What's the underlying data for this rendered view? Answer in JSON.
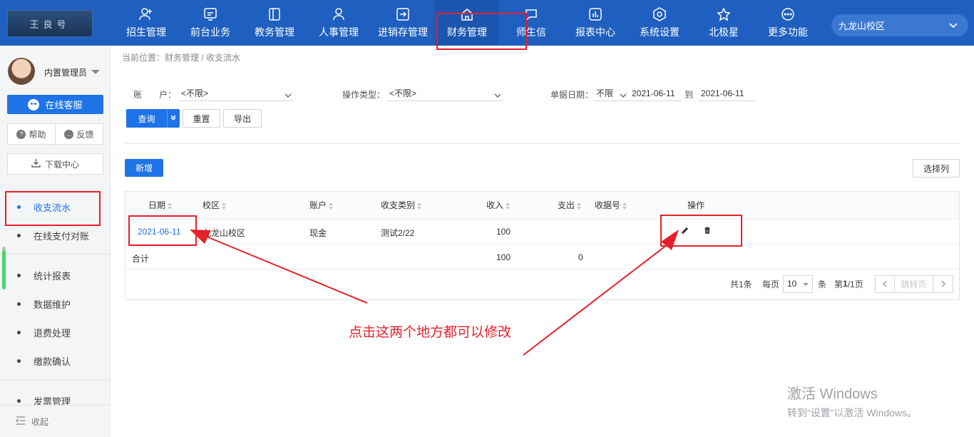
{
  "header": {
    "logo_text": "王良号",
    "nav": [
      {
        "label": "招生管理",
        "icon": "user-add-icon"
      },
      {
        "label": "前台业务",
        "icon": "monitor-icon"
      },
      {
        "label": "教务管理",
        "icon": "book-icon"
      },
      {
        "label": "人事管理",
        "icon": "person-icon"
      },
      {
        "label": "进销存管理",
        "icon": "login-box-icon"
      },
      {
        "label": "财务管理",
        "icon": "home-finance-icon"
      },
      {
        "label": "师生信",
        "icon": "chat-icon"
      },
      {
        "label": "报表中心",
        "icon": "bar-chart-icon"
      },
      {
        "label": "系统设置",
        "icon": "gear-icon"
      },
      {
        "label": "北极星",
        "icon": "star-icon"
      },
      {
        "label": "更多功能",
        "icon": "more-icon"
      }
    ],
    "active_nav": "财务管理",
    "campus": "九龙山校区"
  },
  "sidebar": {
    "user_name": "内置管理员",
    "customer_service": "在线客服",
    "help": "帮助",
    "feedback": "反馈",
    "download_center": "下载中心",
    "menu": [
      {
        "label": "收支流水",
        "active": true
      },
      {
        "label": "在线支付对账",
        "active": false
      },
      {
        "label": "统计报表",
        "active": false
      },
      {
        "label": "数据维护",
        "active": false
      },
      {
        "label": "退费处理",
        "active": false
      },
      {
        "label": "缴款确认",
        "active": false
      },
      {
        "label": "发票管理",
        "active": false
      }
    ],
    "collapse": "收起"
  },
  "breadcrumb": "当前位置：财务管理 / 收支流水",
  "filters": {
    "account_label": "账　　户：",
    "account_value": "<不限>",
    "op_type_label": "操作类型：",
    "op_type_value": "<不限>",
    "date_label": "单据日期：",
    "date_range_mode": "不限",
    "date_from": "2021-06-11",
    "date_to_label": "到",
    "date_to": "2021-06-11"
  },
  "buttons": {
    "query": "查询",
    "reset": "重置",
    "export": "导出",
    "add": "新增",
    "select_columns": "选择列"
  },
  "table": {
    "columns": [
      "日期",
      "校区",
      "账户",
      "收支类别",
      "收入",
      "支出",
      "收据号",
      "操作"
    ],
    "rows": [
      {
        "date": "2021-06-11",
        "campus": "九龙山校区",
        "account": "现金",
        "category": "测试2/22",
        "income": "100",
        "expense": "",
        "receipt": ""
      }
    ],
    "total": {
      "label": "合计",
      "income": "100",
      "expense": "0"
    }
  },
  "pagination": {
    "total": "共1条",
    "per_page_label": "每页",
    "per_page": "10",
    "unit": "条",
    "page_info_prefix": "第",
    "page_current": "1",
    "page_info_suffix": "/1页",
    "jump": "跳转页"
  },
  "annotation": {
    "note": "点击这两个地方都可以修改",
    "color": "#e6202a"
  },
  "watermark": {
    "line1": "激活 Windows",
    "line2": "转到“设置”以激活 Windows。"
  },
  "colors": {
    "topbar": "#1e5fbf",
    "primary": "#1e73e6"
  }
}
